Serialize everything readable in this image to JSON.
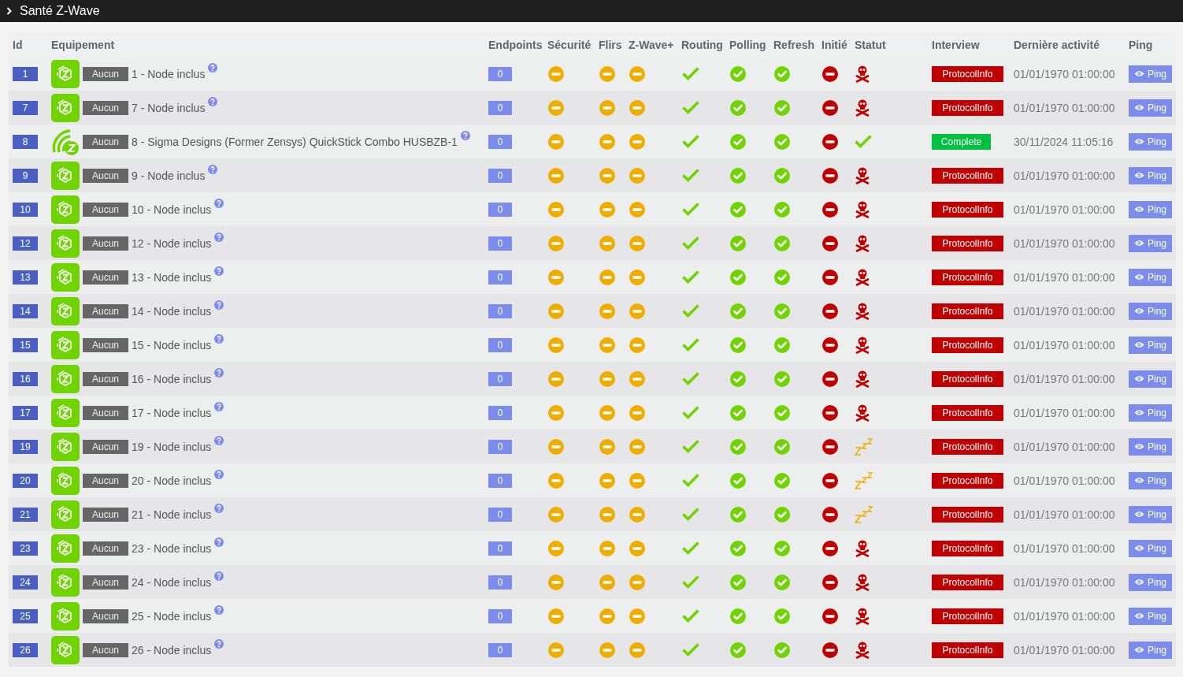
{
  "panel": {
    "title": "Santé Z-Wave"
  },
  "table": {
    "columns": [
      "Id",
      "Equipement",
      "Endpoints",
      "Sécurité",
      "Flirs",
      "Z-Wave+",
      "Routing",
      "Polling",
      "Refresh",
      "Initié",
      "Statut",
      "Interview",
      "Dernière activité",
      "Ping"
    ],
    "rows": [
      {
        "id": "1",
        "device": {
          "kind": "node"
        },
        "object": "Aucun",
        "name": "1 - Node inclus",
        "endpoints": "0",
        "securite": false,
        "flirs": false,
        "zwave_plus": false,
        "routing": true,
        "polling": true,
        "refresh": true,
        "initie": false,
        "status": {
          "kind": "dead"
        },
        "interview": {
          "label": "ProtocolInfo",
          "complete": false
        },
        "last_activity": "01/01/1970 01:00:00",
        "ping": "Ping"
      },
      {
        "id": "7",
        "device": {
          "kind": "node"
        },
        "object": "Aucun",
        "name": "7 - Node inclus",
        "endpoints": "0",
        "securite": false,
        "flirs": false,
        "zwave_plus": false,
        "routing": true,
        "polling": true,
        "refresh": true,
        "initie": false,
        "status": {
          "kind": "dead"
        },
        "interview": {
          "label": "ProtocolInfo",
          "complete": false
        },
        "last_activity": "01/01/1970 01:00:00",
        "ping": "Ping"
      },
      {
        "id": "8",
        "device": {
          "kind": "controller"
        },
        "object": "Aucun",
        "name": "8 - Sigma Designs (Former Zensys) QuickStick Combo HUSBZB-1",
        "endpoints": "0",
        "securite": false,
        "flirs": false,
        "zwave_plus": false,
        "routing": true,
        "polling": true,
        "refresh": true,
        "initie": false,
        "status": {
          "kind": "ok"
        },
        "interview": {
          "label": "Complete",
          "complete": true
        },
        "last_activity": "30/11/2024 11:05:16",
        "ping": "Ping"
      },
      {
        "id": "9",
        "device": {
          "kind": "node"
        },
        "object": "Aucun",
        "name": "9 - Node inclus",
        "endpoints": "0",
        "securite": false,
        "flirs": false,
        "zwave_plus": false,
        "routing": true,
        "polling": true,
        "refresh": true,
        "initie": false,
        "status": {
          "kind": "dead"
        },
        "interview": {
          "label": "ProtocolInfo",
          "complete": false
        },
        "last_activity": "01/01/1970 01:00:00",
        "ping": "Ping"
      },
      {
        "id": "10",
        "device": {
          "kind": "node"
        },
        "object": "Aucun",
        "name": "10 - Node inclus",
        "endpoints": "0",
        "securite": false,
        "flirs": false,
        "zwave_plus": false,
        "routing": true,
        "polling": true,
        "refresh": true,
        "initie": false,
        "status": {
          "kind": "dead"
        },
        "interview": {
          "label": "ProtocolInfo",
          "complete": false
        },
        "last_activity": "01/01/1970 01:00:00",
        "ping": "Ping"
      },
      {
        "id": "12",
        "device": {
          "kind": "node"
        },
        "object": "Aucun",
        "name": "12 - Node inclus",
        "endpoints": "0",
        "securite": false,
        "flirs": false,
        "zwave_plus": false,
        "routing": true,
        "polling": true,
        "refresh": true,
        "initie": false,
        "status": {
          "kind": "dead"
        },
        "interview": {
          "label": "ProtocolInfo",
          "complete": false
        },
        "last_activity": "01/01/1970 01:00:00",
        "ping": "Ping"
      },
      {
        "id": "13",
        "device": {
          "kind": "node"
        },
        "object": "Aucun",
        "name": "13 - Node inclus",
        "endpoints": "0",
        "securite": false,
        "flirs": false,
        "zwave_plus": false,
        "routing": true,
        "polling": true,
        "refresh": true,
        "initie": false,
        "status": {
          "kind": "dead"
        },
        "interview": {
          "label": "ProtocolInfo",
          "complete": false
        },
        "last_activity": "01/01/1970 01:00:00",
        "ping": "Ping"
      },
      {
        "id": "14",
        "device": {
          "kind": "node"
        },
        "object": "Aucun",
        "name": "14 - Node inclus",
        "endpoints": "0",
        "securite": false,
        "flirs": false,
        "zwave_plus": false,
        "routing": true,
        "polling": true,
        "refresh": true,
        "initie": false,
        "status": {
          "kind": "dead"
        },
        "interview": {
          "label": "ProtocolInfo",
          "complete": false
        },
        "last_activity": "01/01/1970 01:00:00",
        "ping": "Ping"
      },
      {
        "id": "15",
        "device": {
          "kind": "node"
        },
        "object": "Aucun",
        "name": "15 - Node inclus",
        "endpoints": "0",
        "securite": false,
        "flirs": false,
        "zwave_plus": false,
        "routing": true,
        "polling": true,
        "refresh": true,
        "initie": false,
        "status": {
          "kind": "dead"
        },
        "interview": {
          "label": "ProtocolInfo",
          "complete": false
        },
        "last_activity": "01/01/1970 01:00:00",
        "ping": "Ping"
      },
      {
        "id": "16",
        "device": {
          "kind": "node"
        },
        "object": "Aucun",
        "name": "16 - Node inclus",
        "endpoints": "0",
        "securite": false,
        "flirs": false,
        "zwave_plus": false,
        "routing": true,
        "polling": true,
        "refresh": true,
        "initie": false,
        "status": {
          "kind": "dead"
        },
        "interview": {
          "label": "ProtocolInfo",
          "complete": false
        },
        "last_activity": "01/01/1970 01:00:00",
        "ping": "Ping"
      },
      {
        "id": "17",
        "device": {
          "kind": "node"
        },
        "object": "Aucun",
        "name": "17 - Node inclus",
        "endpoints": "0",
        "securite": false,
        "flirs": false,
        "zwave_plus": false,
        "routing": true,
        "polling": true,
        "refresh": true,
        "initie": false,
        "status": {
          "kind": "dead"
        },
        "interview": {
          "label": "ProtocolInfo",
          "complete": false
        },
        "last_activity": "01/01/1970 01:00:00",
        "ping": "Ping"
      },
      {
        "id": "19",
        "device": {
          "kind": "node"
        },
        "object": "Aucun",
        "name": "19 - Node inclus",
        "endpoints": "0",
        "securite": false,
        "flirs": false,
        "zwave_plus": false,
        "routing": true,
        "polling": true,
        "refresh": true,
        "initie": false,
        "status": {
          "kind": "asleep"
        },
        "interview": {
          "label": "ProtocolInfo",
          "complete": false
        },
        "last_activity": "01/01/1970 01:00:00",
        "ping": "Ping"
      },
      {
        "id": "20",
        "device": {
          "kind": "node"
        },
        "object": "Aucun",
        "name": "20 - Node inclus",
        "endpoints": "0",
        "securite": false,
        "flirs": false,
        "zwave_plus": false,
        "routing": true,
        "polling": true,
        "refresh": true,
        "initie": false,
        "status": {
          "kind": "asleep"
        },
        "interview": {
          "label": "ProtocolInfo",
          "complete": false
        },
        "last_activity": "01/01/1970 01:00:00",
        "ping": "Ping"
      },
      {
        "id": "21",
        "device": {
          "kind": "node"
        },
        "object": "Aucun",
        "name": "21 - Node inclus",
        "endpoints": "0",
        "securite": false,
        "flirs": false,
        "zwave_plus": false,
        "routing": true,
        "polling": true,
        "refresh": true,
        "initie": false,
        "status": {
          "kind": "asleep"
        },
        "interview": {
          "label": "ProtocolInfo",
          "complete": false
        },
        "last_activity": "01/01/1970 01:00:00",
        "ping": "Ping"
      },
      {
        "id": "23",
        "device": {
          "kind": "node"
        },
        "object": "Aucun",
        "name": "23 - Node inclus",
        "endpoints": "0",
        "securite": false,
        "flirs": false,
        "zwave_plus": false,
        "routing": true,
        "polling": true,
        "refresh": true,
        "initie": false,
        "status": {
          "kind": "dead"
        },
        "interview": {
          "label": "ProtocolInfo",
          "complete": false
        },
        "last_activity": "01/01/1970 01:00:00",
        "ping": "Ping"
      },
      {
        "id": "24",
        "device": {
          "kind": "node"
        },
        "object": "Aucun",
        "name": "24 - Node inclus",
        "endpoints": "0",
        "securite": false,
        "flirs": false,
        "zwave_plus": false,
        "routing": true,
        "polling": true,
        "refresh": true,
        "initie": false,
        "status": {
          "kind": "dead"
        },
        "interview": {
          "label": "ProtocolInfo",
          "complete": false
        },
        "last_activity": "01/01/1970 01:00:00",
        "ping": "Ping"
      },
      {
        "id": "25",
        "device": {
          "kind": "node"
        },
        "object": "Aucun",
        "name": "25 - Node inclus",
        "endpoints": "0",
        "securite": false,
        "flirs": false,
        "zwave_plus": false,
        "routing": true,
        "polling": true,
        "refresh": true,
        "initie": false,
        "status": {
          "kind": "dead"
        },
        "interview": {
          "label": "ProtocolInfo",
          "complete": false
        },
        "last_activity": "01/01/1970 01:00:00",
        "ping": "Ping"
      },
      {
        "id": "26",
        "device": {
          "kind": "node"
        },
        "object": "Aucun",
        "name": "26 - Node inclus",
        "endpoints": "0",
        "securite": false,
        "flirs": false,
        "zwave_plus": false,
        "routing": true,
        "polling": true,
        "refresh": true,
        "initie": false,
        "status": {
          "kind": "dead"
        },
        "interview": {
          "label": "ProtocolInfo",
          "complete": false
        },
        "last_activity": "01/01/1970 01:00:00",
        "ping": "Ping"
      }
    ]
  }
}
